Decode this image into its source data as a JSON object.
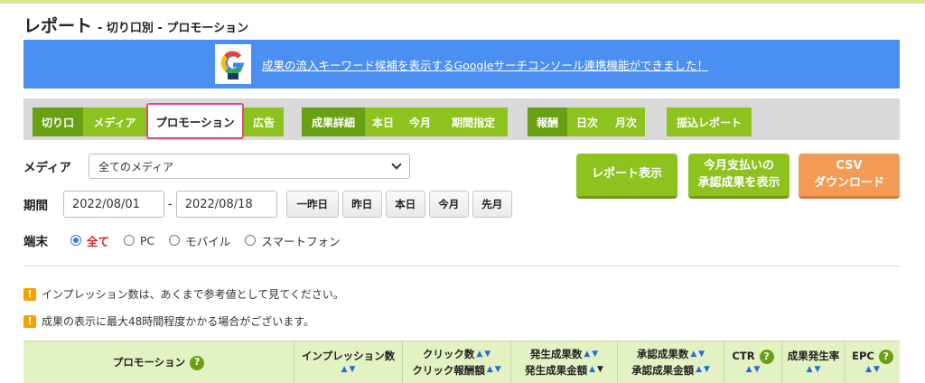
{
  "page": {
    "title": "レポート",
    "subtitle": "- 切り口別 - プロモーション"
  },
  "banner": {
    "text": "成果の流入キーワード候補を表示するGoogleサーチコンソール連携機能ができました！",
    "icon": "google-logo-icon"
  },
  "tabs": {
    "dimension": [
      "切り口",
      "メディア",
      "プロモーション",
      "広告"
    ],
    "metric": [
      "成果詳細",
      "本日",
      "今月",
      "期間指定"
    ],
    "reward": [
      "報酬",
      "日次",
      "月次"
    ],
    "transfer": [
      "振込レポート"
    ]
  },
  "filters": {
    "media_label": "メディア",
    "media_value": "全てのメディア",
    "period_label": "期間",
    "date_from": "2022/08/01",
    "date_sep": "-",
    "date_to": "2022/08/18",
    "quick": [
      "一昨日",
      "昨日",
      "本日",
      "今月",
      "先月"
    ],
    "device_label": "端末",
    "devices": [
      "全て",
      "PC",
      "モバイル",
      "スマートフォン"
    ],
    "device_selected": "全て"
  },
  "actions": {
    "report": "レポート表示",
    "approved_line1": "今月支払いの",
    "approved_line2": "承認成果を表示",
    "csv_line1": "CSV",
    "csv_line2": "ダウンロード"
  },
  "notices": [
    "インプレッション数は、あくまで参考値として見てください。",
    "成果の表示に最大48時間程度かかる場合がございます。"
  ],
  "table": {
    "headers": {
      "promotion": "プロモーション",
      "impressions": "インプレッション数",
      "clicks": "クリック数",
      "click_reward": "クリック報酬額",
      "generated": "発生成果数",
      "generated_amount": "発生成果金額",
      "approved": "承認成果数",
      "approved_amount": "承認成果金額",
      "ctr": "CTR",
      "cvr": "成果発生率",
      "epc": "EPC"
    },
    "sort_up": "▲",
    "sort_down": "▼",
    "help_glyph": "?"
  },
  "colors": {
    "green": "#8dc21f",
    "dark_green": "#6aa013",
    "banner_blue": "#4c8ff2",
    "orange": "#f39a55",
    "active_tab_border": "#e3477e"
  }
}
